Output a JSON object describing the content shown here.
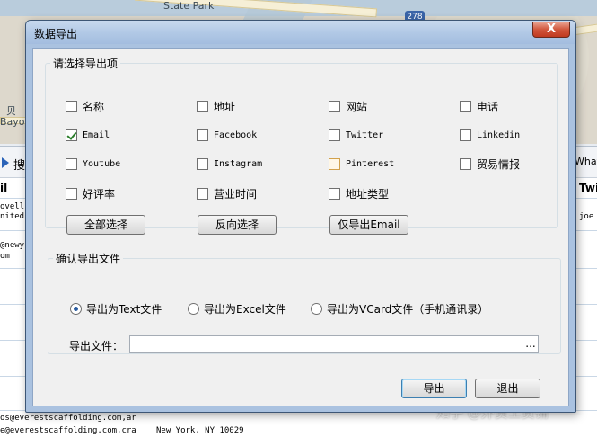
{
  "background": {
    "map_labels": {
      "state_park": "State Park",
      "shield": "278",
      "bayonne_1": "贝",
      "bayonne_2": "Bayo"
    },
    "toolbar": {
      "search_label": "搜",
      "what_label": "What"
    },
    "table": {
      "head_left": "il",
      "head_right": "Twi",
      "cells": [
        "ovell",
        "nited",
        "joe",
        "@newy",
        "om",
        "os@everestscaffolding.com,ar",
        "e@everestscaffolding.com,cra",
        "New York, NY 10029"
      ]
    },
    "watermark": "知乎 @外贸工货铺"
  },
  "dialog": {
    "title": "数据导出",
    "close_label": "X",
    "select_group": {
      "legend": "请选择导出项",
      "options": [
        {
          "label": "名称",
          "checked": false
        },
        {
          "label": "地址",
          "checked": false
        },
        {
          "label": "网站",
          "checked": false
        },
        {
          "label": "电话",
          "checked": false
        },
        {
          "label": "Email",
          "checked": true
        },
        {
          "label": "Facebook",
          "checked": false
        },
        {
          "label": "Twitter",
          "checked": false
        },
        {
          "label": "Linkedin",
          "checked": false
        },
        {
          "label": "Youtube",
          "checked": false
        },
        {
          "label": "Instagram",
          "checked": false
        },
        {
          "label": "Pinterest",
          "checked": false
        },
        {
          "label": "贸易情报",
          "checked": false
        },
        {
          "label": "好评率",
          "checked": false
        },
        {
          "label": "营业时间",
          "checked": false
        },
        {
          "label": "地址类型",
          "checked": false
        }
      ],
      "buttons": {
        "select_all": "全部选择",
        "invert": "反向选择",
        "email_only": "仅导出Email"
      }
    },
    "confirm_group": {
      "legend": "确认导出文件",
      "formats": [
        {
          "label": "导出为Text文件",
          "selected": true
        },
        {
          "label": "导出为Excel文件",
          "selected": false
        },
        {
          "label": "导出为VCard文件（手机通讯录）",
          "selected": false
        }
      ],
      "file_label": "导出文件：",
      "file_value": "",
      "browse_label": "..."
    },
    "footer": {
      "export_label": "导出",
      "exit_label": "退出"
    }
  }
}
